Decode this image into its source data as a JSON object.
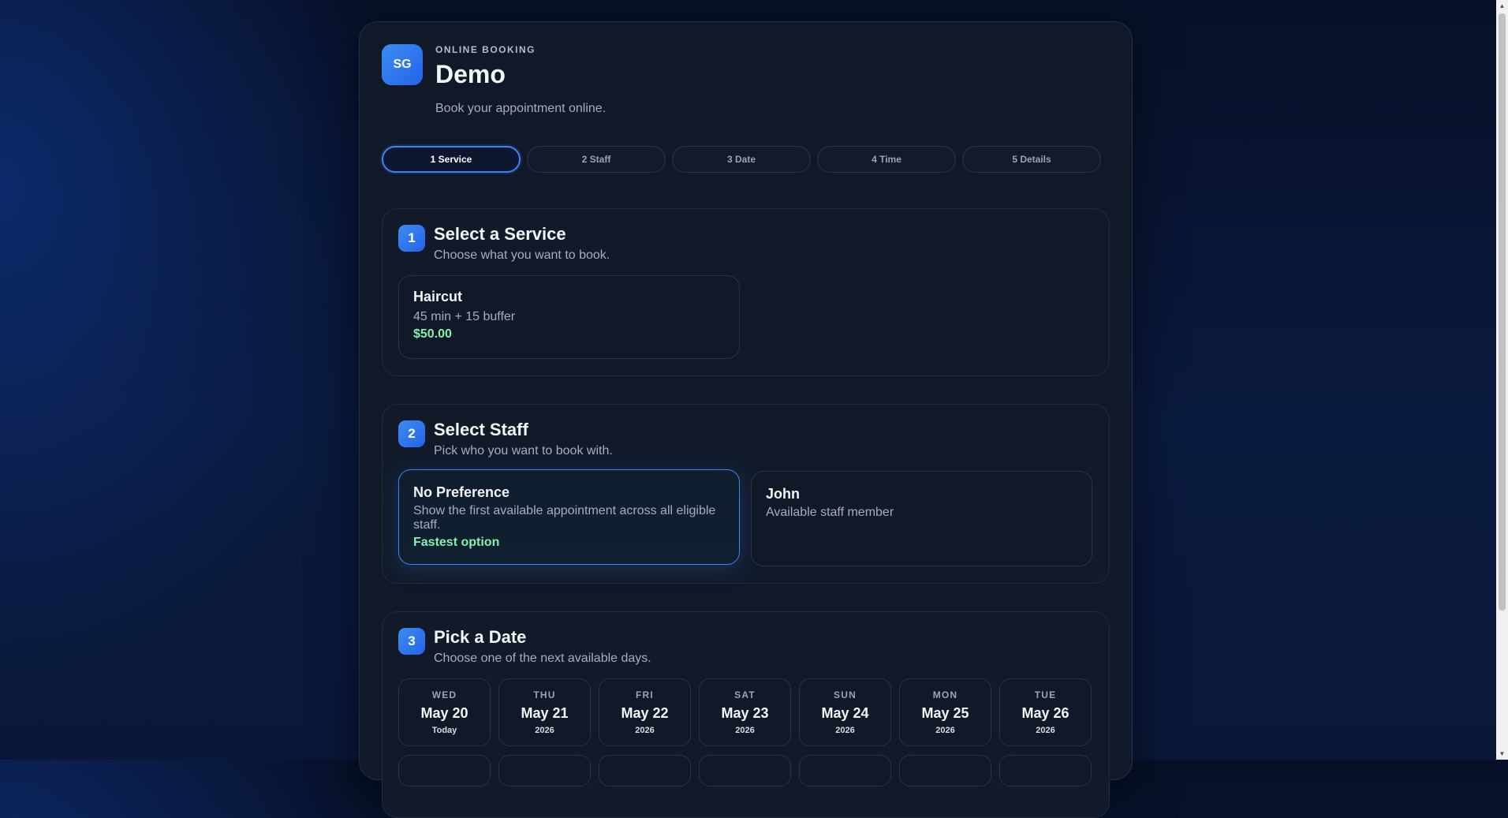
{
  "header": {
    "logo_initials": "SG",
    "eyebrow": "ONLINE BOOKING",
    "title": "Demo",
    "subtitle": "Book your appointment online."
  },
  "steps": [
    {
      "label": "1 Service",
      "active": true
    },
    {
      "label": "2 Staff",
      "active": false
    },
    {
      "label": "3 Date",
      "active": false
    },
    {
      "label": "4 Time",
      "active": false
    },
    {
      "label": "5 Details",
      "active": false
    }
  ],
  "service_section": {
    "number": "1",
    "title": "Select a Service",
    "subtitle": "Choose what you want to book.",
    "services": [
      {
        "name": "Haircut",
        "duration": "45 min + 15 buffer",
        "price": "$50.00"
      }
    ]
  },
  "staff_section": {
    "number": "2",
    "title": "Select Staff",
    "subtitle": "Pick who you want to book with.",
    "options": [
      {
        "name": "No Preference",
        "description": "Show the first available appointment across all eligible staff.",
        "tag": "Fastest option",
        "selected": true
      },
      {
        "name": "John",
        "description": "Available staff member",
        "selected": false
      }
    ]
  },
  "date_section": {
    "number": "3",
    "title": "Pick a Date",
    "subtitle": "Choose one of the next available days.",
    "dates": [
      {
        "dow": "WED",
        "date": "May 20",
        "sub": "Today"
      },
      {
        "dow": "THU",
        "date": "May 21",
        "sub": "2026"
      },
      {
        "dow": "FRI",
        "date": "May 22",
        "sub": "2026"
      },
      {
        "dow": "SAT",
        "date": "May 23",
        "sub": "2026"
      },
      {
        "dow": "SUN",
        "date": "May 24",
        "sub": "2026"
      },
      {
        "dow": "MON",
        "date": "May 25",
        "sub": "2026"
      },
      {
        "dow": "TUE",
        "date": "May 26",
        "sub": "2026"
      }
    ]
  },
  "colors": {
    "accent": "#3b82f6",
    "price_green": "#86efac",
    "card_bg": "#111827"
  }
}
